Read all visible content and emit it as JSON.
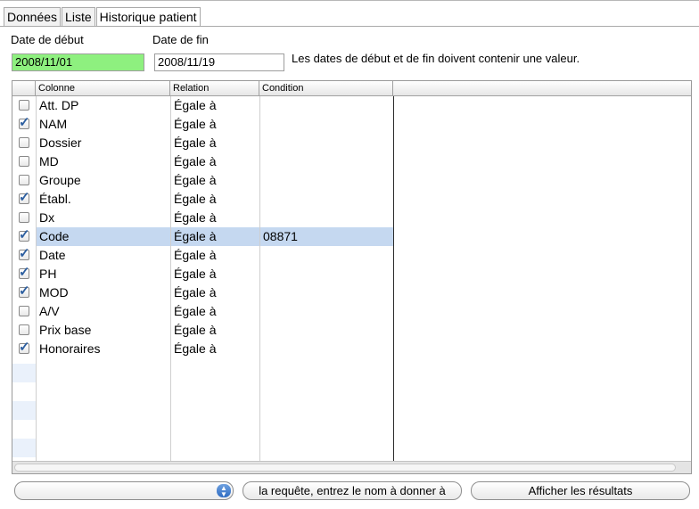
{
  "tabs": [
    "Données",
    "Liste",
    "Historique patient"
  ],
  "dates": {
    "start_label": "Date de début",
    "start_value": "2008/11/01",
    "end_label": "Date de fin",
    "end_value": "2008/11/19",
    "note": "Les dates de début et de fin doivent contenir une valeur."
  },
  "grid": {
    "headers": [
      "Colonne",
      "Relation",
      "Condition"
    ],
    "rows": [
      {
        "checked": false,
        "colonne": "Att. DP",
        "relation": "Égale à",
        "condition": ""
      },
      {
        "checked": true,
        "colonne": "NAM",
        "relation": "Égale à",
        "condition": ""
      },
      {
        "checked": false,
        "colonne": "Dossier",
        "relation": "Égale à",
        "condition": ""
      },
      {
        "checked": false,
        "colonne": "MD",
        "relation": "Égale à",
        "condition": ""
      },
      {
        "checked": false,
        "colonne": "Groupe",
        "relation": "Égale à",
        "condition": ""
      },
      {
        "checked": true,
        "colonne": "Établ.",
        "relation": "Égale à",
        "condition": ""
      },
      {
        "checked": false,
        "colonne": "Dx",
        "relation": "Égale à",
        "condition": ""
      },
      {
        "checked": true,
        "colonne": "Code",
        "relation": "Égale à",
        "condition": "08871",
        "selected": true
      },
      {
        "checked": true,
        "colonne": "Date",
        "relation": "Égale à",
        "condition": ""
      },
      {
        "checked": true,
        "colonne": "PH",
        "relation": "Égale à",
        "condition": ""
      },
      {
        "checked": true,
        "colonne": "MOD",
        "relation": "Égale à",
        "condition": ""
      },
      {
        "checked": false,
        "colonne": "A/V",
        "relation": "Égale à",
        "condition": ""
      },
      {
        "checked": false,
        "colonne": "Prix base",
        "relation": "Égale à",
        "condition": ""
      },
      {
        "checked": true,
        "colonne": "Honoraires",
        "relation": "Égale à",
        "condition": ""
      }
    ]
  },
  "bottom": {
    "popup_value": "",
    "save_label": "la requête, entrez le nom à donner à",
    "show_results_label": "Afficher les résultats"
  },
  "colors": {
    "start_field_bg": "#8ef07f",
    "selected_row": "#c5d8f0",
    "check": "#2d5fa0"
  }
}
